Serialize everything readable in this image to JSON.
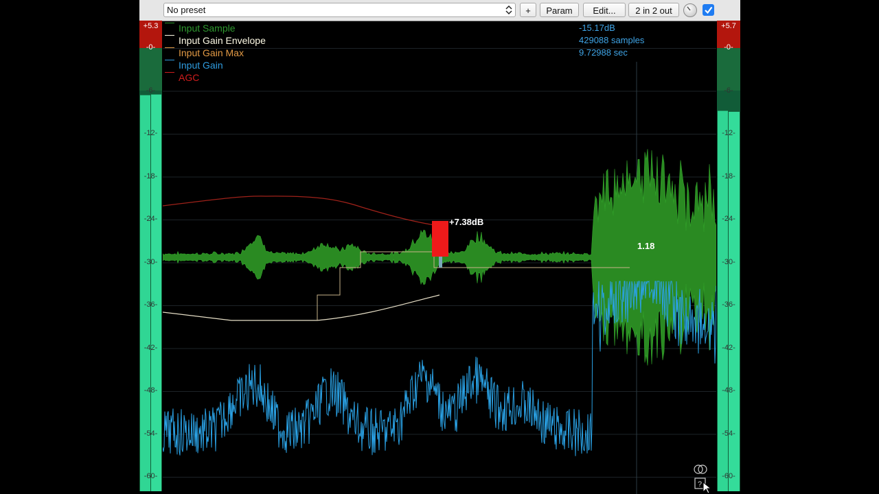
{
  "toolbar": {
    "preset_value": "No preset",
    "plus_label": "+",
    "param_label": "Param",
    "edit_label": "Edit...",
    "io_label": "2 in 2 out"
  },
  "meters": {
    "left": {
      "clip_value": "+5.3",
      "level": -6.5
    },
    "right": {
      "clip_value": "+5.7",
      "level": -8.5
    },
    "scale": [
      "-0-",
      "-6-",
      "-12-",
      "-18-",
      "-24-",
      "-30-",
      "-36-",
      "-42-",
      "-48-",
      "-54-",
      "-60-"
    ]
  },
  "legend": [
    {
      "label": "Input Sample",
      "color": "#2f9a2f"
    },
    {
      "label": "Input Gain Envelope",
      "color": "#fffbe6"
    },
    {
      "label": "Input Gain Max",
      "color": "#e39a45"
    },
    {
      "label": "Input Gain",
      "color": "#2f9de0"
    },
    {
      "label": "AGC",
      "color": "#d11d1d"
    }
  ],
  "readout": {
    "level": "-15.17dB",
    "samples": "429088 samples",
    "time": "9.72988 sec"
  },
  "annotations": {
    "gain_badge": "+7.38dB",
    "ratio_label": "1.18"
  },
  "icons": [
    "rings-icon",
    "help-icon",
    "mouse-cursor-icon"
  ]
}
